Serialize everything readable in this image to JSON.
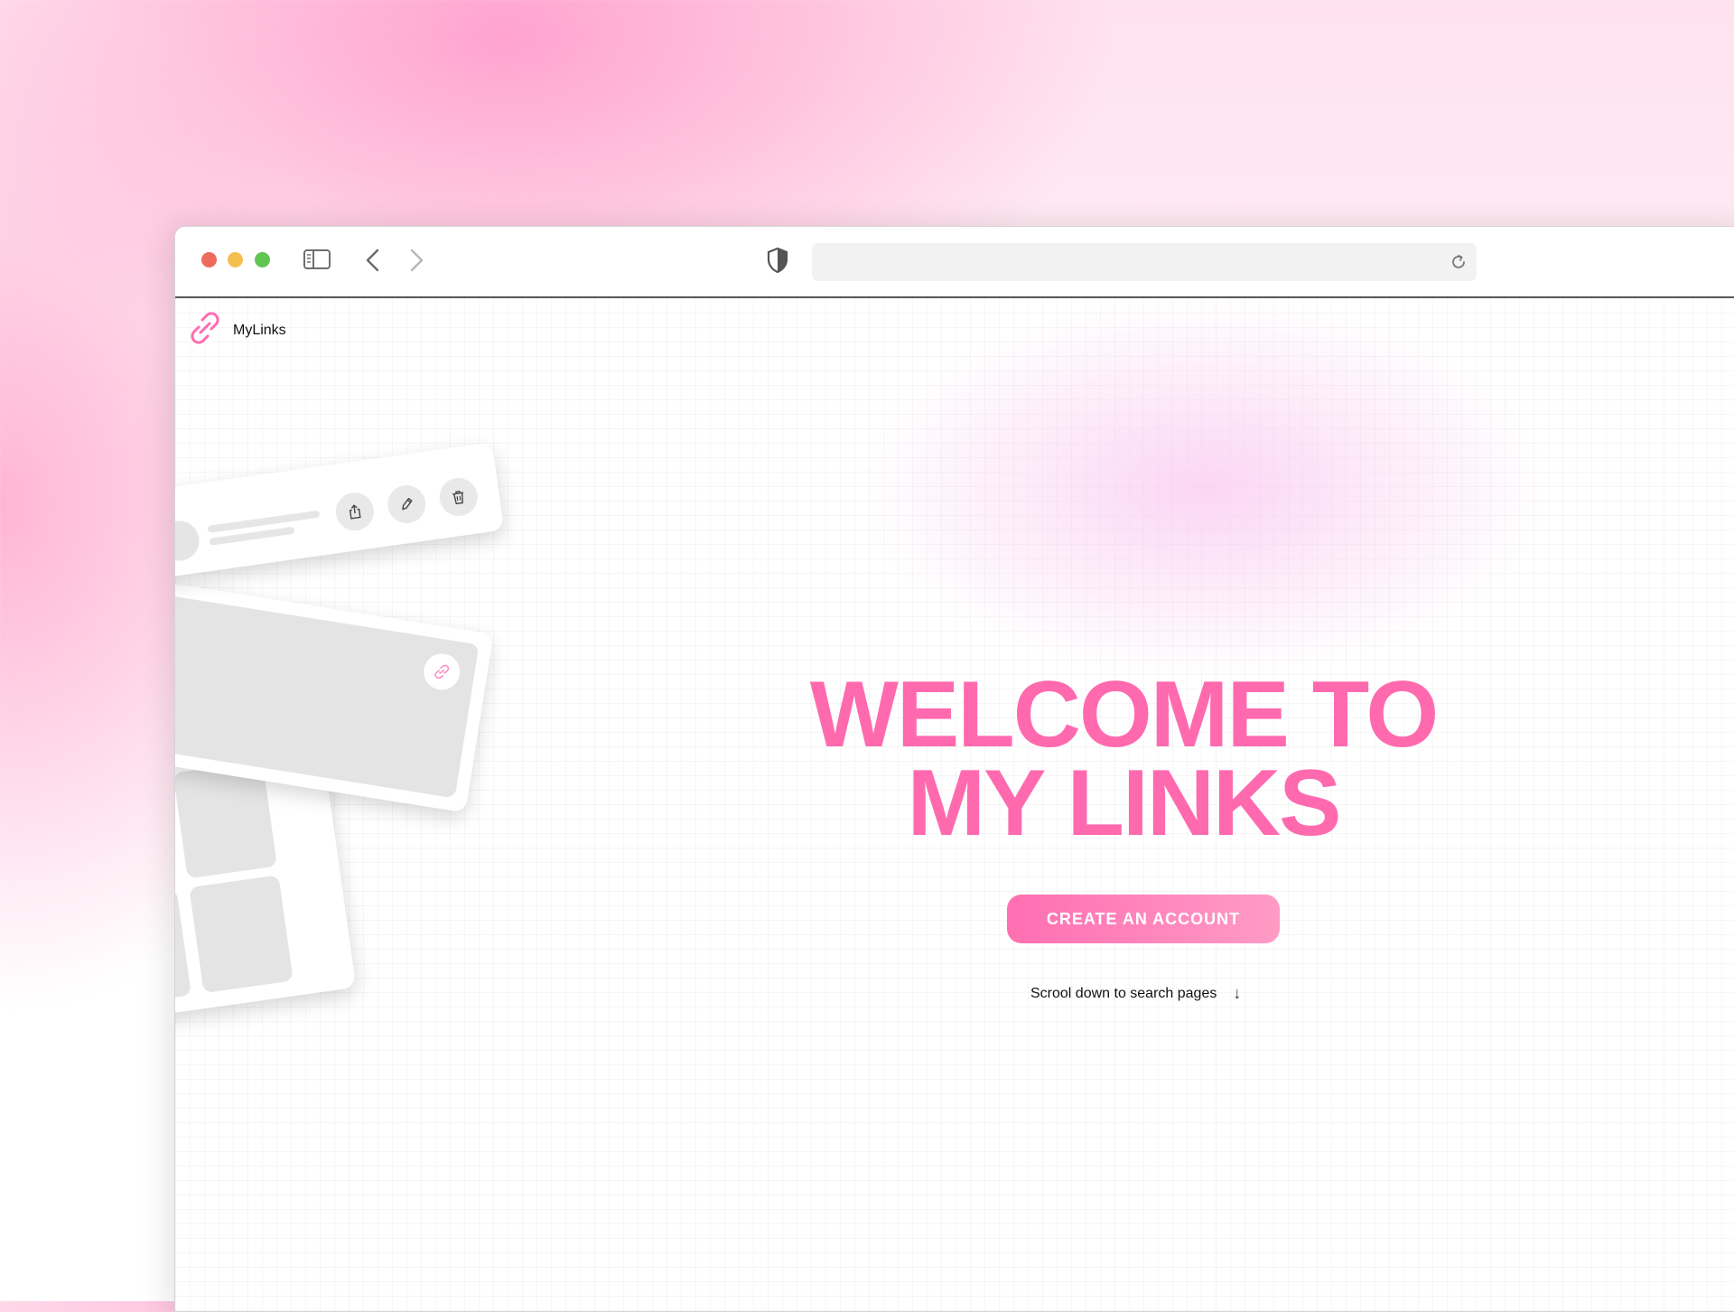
{
  "colors": {
    "brand": "#ff6aaf",
    "cta_start": "#ff6fb2",
    "cta_end": "#ff9bc5",
    "traffic_red": "#ed6a5e",
    "traffic_yellow": "#f5bf4f",
    "traffic_green": "#61c554"
  },
  "browser": {
    "address": {
      "value": "",
      "placeholder": ""
    },
    "icons": [
      "sidebar-toggle-icon",
      "back-arrow-icon",
      "forward-arrow-icon",
      "shield-icon",
      "reload-icon"
    ]
  },
  "page": {
    "brand": {
      "name": "MyLinks",
      "icon": "link-icon"
    },
    "hero": {
      "title_line1": "WELCOME TO",
      "title_line2": "MY LINKS",
      "cta_label": "CREATE AN ACCOUNT",
      "scroll_hint": "Scrool down to search pages",
      "scroll_icon": "↓"
    },
    "illustration": {
      "icons": [
        "share-icon",
        "pencil-icon",
        "trash-icon",
        "link-icon"
      ]
    }
  }
}
